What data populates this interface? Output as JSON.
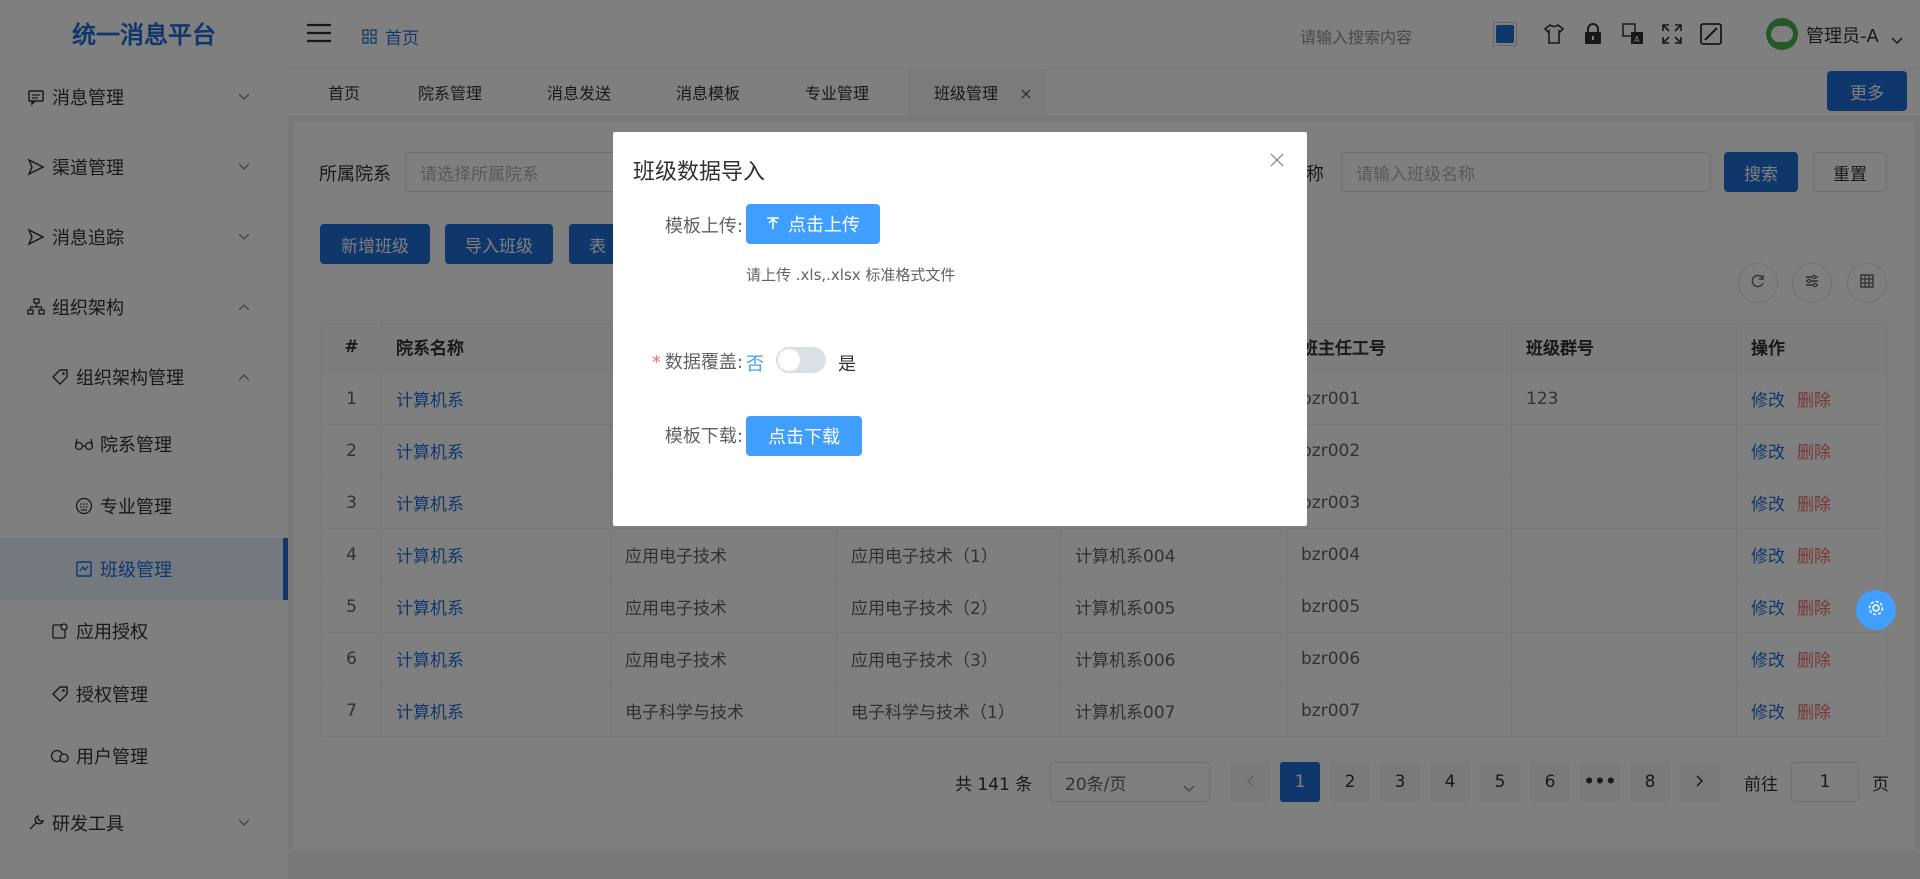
{
  "app": {
    "title": "统一消息平台"
  },
  "sidebar": {
    "items": [
      {
        "label": "消息管理",
        "icon": "chat-icon"
      },
      {
        "label": "渠道管理",
        "icon": "send-icon"
      },
      {
        "label": "消息追踪",
        "icon": "send-icon"
      },
      {
        "label": "组织架构",
        "icon": "org-icon"
      },
      {
        "label": "组织架构管理",
        "icon": "tag-icon"
      },
      {
        "label": "院系管理",
        "icon": "glasses-icon"
      },
      {
        "label": "专业管理",
        "icon": "keyboard-icon"
      },
      {
        "label": "班级管理",
        "icon": "class-icon"
      },
      {
        "label": "应用授权",
        "icon": "app-icon"
      },
      {
        "label": "授权管理",
        "icon": "tag-icon"
      },
      {
        "label": "用户管理",
        "icon": "user-icon"
      },
      {
        "label": "研发工具",
        "icon": "tool-icon"
      }
    ]
  },
  "header": {
    "breadcrumb": "首页",
    "search_placeholder": "请输入搜索内容",
    "user": "管理员-A"
  },
  "tabs": [
    "首页",
    "院系管理",
    "消息发送",
    "消息模板",
    "专业管理",
    "班级管理"
  ],
  "more_label": "更多",
  "filters": {
    "dept_label": "所属院系",
    "dept_placeholder": "请选择所属院系",
    "class_label_tail": "称",
    "class_placeholder": "请输入班级名称",
    "search": "搜索",
    "reset": "重置"
  },
  "actions": {
    "add": "新增班级",
    "import": "导入班级",
    "export_partial": "表"
  },
  "table": {
    "headers": [
      "#",
      "院系名称",
      "",
      "",
      "",
      "班主任工号",
      "班级群号",
      "操作"
    ],
    "rows": [
      [
        "1",
        "计算机系",
        "",
        "",
        "",
        "bzr001",
        "123"
      ],
      [
        "2",
        "计算机系",
        "",
        "",
        "",
        "bzr002",
        ""
      ],
      [
        "3",
        "计算机系",
        "",
        "",
        "",
        "bzr003",
        ""
      ],
      [
        "4",
        "计算机系",
        "应用电子技术",
        "应用电子技术（1）",
        "计算机系004",
        "bzr004",
        ""
      ],
      [
        "5",
        "计算机系",
        "应用电子技术",
        "应用电子技术（2）",
        "计算机系005",
        "bzr005",
        ""
      ],
      [
        "6",
        "计算机系",
        "应用电子技术",
        "应用电子技术（3）",
        "计算机系006",
        "bzr006",
        ""
      ],
      [
        "7",
        "计算机系",
        "电子科学与技术",
        "电子科学与技术（1）",
        "计算机系007",
        "bzr007",
        ""
      ]
    ],
    "edit": "修改",
    "delete": "删除"
  },
  "pagination": {
    "total": "共 141 条",
    "page_size": "20条/页",
    "pages": [
      "1",
      "2",
      "3",
      "4",
      "5",
      "6",
      "8"
    ],
    "goto_label": "前往",
    "goto_value": "1",
    "page_suffix": "页"
  },
  "dialog": {
    "title": "班级数据导入",
    "upload_label": "模板上传:",
    "upload_button": "点击上传",
    "upload_tip": "请上传 .xls,.xlsx 标准格式文件",
    "overwrite_label": "数据覆盖:",
    "no": "否",
    "yes": "是",
    "download_label": "模板下载:",
    "download_button": "点击下载"
  },
  "colors": {
    "primary": "#1f6fd6",
    "dialog_button": "#409eff",
    "danger": "#f56c6c"
  }
}
